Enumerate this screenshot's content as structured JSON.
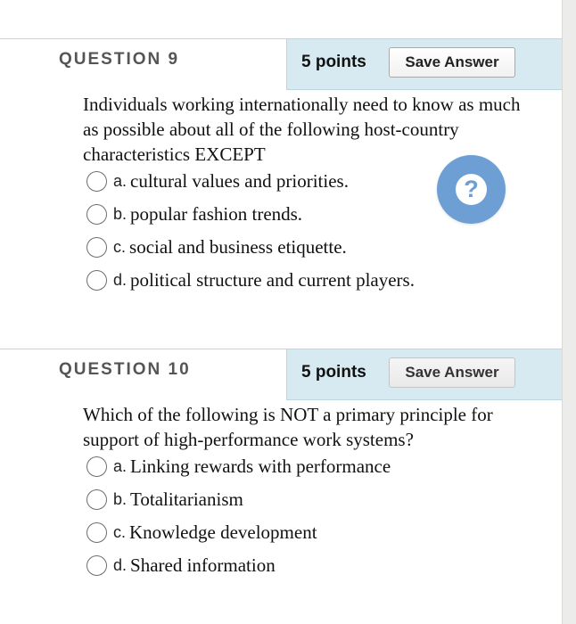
{
  "questions": [
    {
      "title": "QUESTION 9",
      "points": "5 points",
      "save_label": "Save Answer",
      "text": "Individuals working internationally need to know as much as possible about all of the following host-country characteristics EXCEPT",
      "options": [
        {
          "letter": "a.",
          "text": "cultural values and priorities."
        },
        {
          "letter": "b.",
          "text": "popular fashion trends."
        },
        {
          "letter": "c.",
          "text": "social and business etiquette."
        },
        {
          "letter": "d.",
          "text": "political structure and current players."
        }
      ]
    },
    {
      "title": "QUESTION 10",
      "points": "5 points",
      "save_label": "Save Answer",
      "text": "Which of the following is NOT a primary principle for support of high-performance work systems?",
      "options": [
        {
          "letter": "a.",
          "text": "Linking rewards with performance"
        },
        {
          "letter": "b.",
          "text": "Totalitarianism"
        },
        {
          "letter": "c.",
          "text": "Knowledge development"
        },
        {
          "letter": "d.",
          "text": "Shared information"
        }
      ]
    }
  ],
  "help_button": {
    "icon": "question-mark-icon",
    "glyph": "?"
  },
  "colors": {
    "header_band": "#d7eaf1",
    "help_button": "#6d9fd4"
  }
}
